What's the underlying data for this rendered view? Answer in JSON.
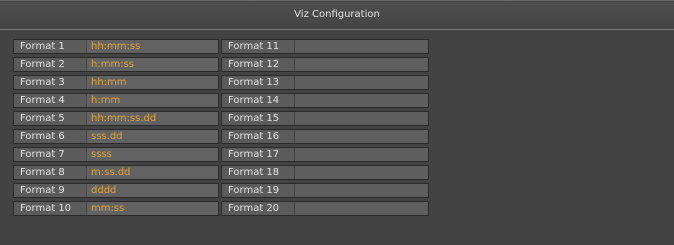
{
  "title": "Viz Configuration",
  "left_rows": [
    {
      "label": "Format 1",
      "value": "hh:mm:ss"
    },
    {
      "label": "Format 2",
      "value": "h:mm:ss"
    },
    {
      "label": "Format 3",
      "value": "hh:mm"
    },
    {
      "label": "Format 4",
      "value": "h:mm"
    },
    {
      "label": "Format 5",
      "value": "hh:mm:ss.dd"
    },
    {
      "label": "Format 6",
      "value": "sss.dd"
    },
    {
      "label": "Format 7",
      "value": "ssss"
    },
    {
      "label": "Format 8",
      "value": "m:ss.dd"
    },
    {
      "label": "Format 9",
      "value": "dddd"
    },
    {
      "label": "Format 10",
      "value": "mm:ss"
    }
  ],
  "right_rows": [
    {
      "label": "Format 11",
      "value": ""
    },
    {
      "label": "Format 12",
      "value": ""
    },
    {
      "label": "Format 13",
      "value": ""
    },
    {
      "label": "Format 14",
      "value": ""
    },
    {
      "label": "Format 15",
      "value": ""
    },
    {
      "label": "Format 16",
      "value": ""
    },
    {
      "label": "Format 17",
      "value": ""
    },
    {
      "label": "Format 18",
      "value": ""
    },
    {
      "label": "Format 19",
      "value": ""
    },
    {
      "label": "Format 20",
      "value": ""
    }
  ]
}
